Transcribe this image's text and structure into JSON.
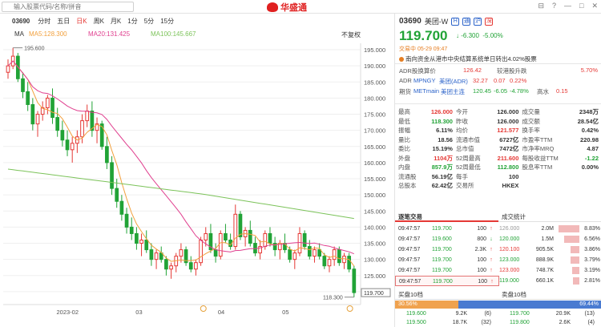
{
  "search": {
    "placeholder": "输入股票代码/名称/拼音"
  },
  "brand": {
    "name": "华盛通"
  },
  "window": {
    "buttons": [
      "⊟",
      "?",
      "—",
      "□",
      "✕"
    ]
  },
  "chart_toolbar": {
    "code": "03690",
    "periods": [
      "分时",
      "五日",
      "日K",
      "周K",
      "月K",
      "1分",
      "5分",
      "15分"
    ],
    "active_period": "日K"
  },
  "ma": {
    "label": "MA",
    "ma5": "MA5:128.300",
    "ma20": "MA20:131.425",
    "ma100": "MA100:145.667",
    "adjust": "不复权"
  },
  "chart_data": {
    "type": "candlestick",
    "x_labels": [
      "2023-02",
      "03",
      "04",
      "05"
    ],
    "y_ticks": [
      195,
      190,
      185,
      180,
      175,
      170,
      165,
      160,
      155,
      150,
      145,
      140,
      135,
      130,
      125,
      120
    ],
    "y_range": [
      116,
      197
    ],
    "high_marker": "195.600",
    "low_marker": "118.300",
    "last_price_tag": "119.700",
    "ma_colors": {
      "ma5": "#f2a03d",
      "ma20": "#e0408f",
      "ma100": "#7cc35a"
    },
    "up_color": "#e53935",
    "down_color": "#21a336",
    "candles": [
      [
        188,
        192,
        186,
        190
      ],
      [
        190,
        195.6,
        189,
        193
      ],
      [
        193,
        194,
        185,
        186
      ],
      [
        186,
        188,
        180,
        182
      ],
      [
        182,
        185,
        176,
        178
      ],
      [
        178,
        180,
        170,
        172
      ],
      [
        172,
        176,
        168,
        175
      ],
      [
        175,
        179,
        173,
        177
      ],
      [
        177,
        181,
        175,
        180
      ],
      [
        180,
        183,
        172,
        174
      ],
      [
        174,
        177,
        168,
        170
      ],
      [
        170,
        173,
        165,
        167
      ],
      [
        167,
        170,
        162,
        164
      ],
      [
        164,
        168,
        160,
        166
      ],
      [
        166,
        170,
        163,
        168
      ],
      [
        168,
        175,
        166,
        173
      ],
      [
        173,
        178,
        171,
        176
      ],
      [
        176,
        179,
        168,
        170
      ],
      [
        170,
        174,
        166,
        172
      ],
      [
        172,
        173,
        164,
        165
      ],
      [
        165,
        168,
        158,
        160
      ],
      [
        160,
        162,
        150,
        152
      ],
      [
        152,
        155,
        146,
        148
      ],
      [
        148,
        150,
        142,
        144
      ],
      [
        144,
        146,
        138,
        140
      ],
      [
        140,
        143,
        136,
        138
      ],
      [
        138,
        140,
        133,
        135
      ],
      [
        135,
        138,
        131,
        136
      ],
      [
        136,
        139,
        132,
        133
      ],
      [
        133,
        135,
        128,
        130
      ],
      [
        130,
        133,
        127,
        132
      ],
      [
        132,
        134,
        129,
        130
      ],
      [
        130,
        131,
        125,
        127
      ],
      [
        127,
        129,
        124,
        128
      ],
      [
        128,
        132,
        126,
        131
      ],
      [
        131,
        135,
        129,
        133
      ],
      [
        133,
        134,
        128,
        129
      ],
      [
        129,
        131,
        126,
        127
      ],
      [
        127,
        130,
        125,
        129
      ],
      [
        129,
        137,
        128,
        136
      ],
      [
        136,
        140,
        134,
        138
      ],
      [
        138,
        141,
        132,
        133
      ],
      [
        133,
        135,
        129,
        131
      ],
      [
        131,
        139,
        130,
        138
      ],
      [
        138,
        141,
        135,
        136
      ],
      [
        136,
        138,
        133,
        134
      ],
      [
        134,
        147,
        133,
        144
      ],
      [
        144,
        145,
        136,
        137
      ],
      [
        137,
        140,
        134,
        139
      ],
      [
        139,
        142,
        134,
        135
      ],
      [
        135,
        137,
        131,
        132
      ],
      [
        132,
        136,
        130,
        134
      ],
      [
        134,
        139,
        133,
        138
      ],
      [
        138,
        140,
        134,
        135
      ],
      [
        135,
        137,
        131,
        133
      ],
      [
        133,
        136,
        130,
        135
      ],
      [
        135,
        138,
        132,
        133
      ],
      [
        133,
        134,
        129,
        130
      ],
      [
        130,
        133,
        127,
        132
      ],
      [
        132,
        140,
        131,
        138
      ],
      [
        138,
        139,
        133,
        134
      ],
      [
        134,
        136,
        130,
        131
      ],
      [
        131,
        134,
        129,
        133
      ],
      [
        133,
        135,
        130,
        131
      ],
      [
        131,
        132,
        127,
        128
      ],
      [
        128,
        131,
        126,
        130
      ],
      [
        130,
        134,
        128,
        133
      ],
      [
        133,
        134,
        128,
        129
      ],
      [
        129,
        132,
        127,
        131
      ],
      [
        131,
        132,
        126,
        127
      ],
      [
        127,
        128,
        118.3,
        119.7
      ]
    ]
  },
  "quote": {
    "code": "03690",
    "name": "美团-W",
    "badges": [
      "H",
      "通",
      "沪",
      "深"
    ],
    "price": "119.700",
    "arrow": "↓",
    "change": "-6.300",
    "change_pct": "-5.00%",
    "trade_time": "交易中 05-29 09:47",
    "news": "南向资金从港市中央结算系统单日转出4.02%股票"
  },
  "adr": [
    {
      "label": "ADR股换算价",
      "value": "126.42",
      "label2": "较港股升跌",
      "value2": "5.70%"
    },
    {
      "label": "ADR",
      "code": "MPNGY",
      "name": "美团(ADR)",
      "value": "32.27",
      "chg": "0.07",
      "pct": "0.22%"
    },
    {
      "label": "期货",
      "code": "METmain",
      "name": "美团主连",
      "value": "120.45",
      "chg": "-6.05",
      "pct": "-4.78%",
      "label2": "高水",
      "value2": "0.15"
    }
  ],
  "stats": [
    [
      "最高",
      "126.000",
      "今开",
      "126.000",
      "成交量",
      "2348万"
    ],
    [
      "最低",
      "118.300",
      "昨收",
      "126.000",
      "成交额",
      "28.54亿"
    ],
    [
      "振幅",
      "6.11%",
      "均价",
      "121.577",
      "换手率",
      "0.42%"
    ],
    [
      "量比",
      "18.56",
      "流通市值",
      "6727亿",
      "市盈率TTM",
      "220.98"
    ],
    [
      "委比",
      "15.19%",
      "总市值",
      "7472亿",
      "市净率MRQ",
      "4.87"
    ],
    [
      "外盘",
      "1104万",
      "52周最高",
      "211.600",
      "每股收益TTM",
      "-1.22"
    ],
    [
      "内盘",
      "857.9万",
      "52周最低",
      "112.800",
      "股息率TTM",
      "0.00%"
    ],
    [
      "流通股",
      "56.19亿",
      "每手",
      "100",
      "",
      ""
    ],
    [
      "总股本",
      "62.42亿",
      "交易所",
      "HKEX",
      "",
      ""
    ]
  ],
  "tabs": {
    "trades": "逐笔交易",
    "stats": "成交统计",
    "book": "买盘10档",
    "book_sell": "卖盘10档"
  },
  "trades": [
    {
      "time": "09:47:57",
      "price": "119.700",
      "vol": "100",
      "dir": "↑"
    },
    {
      "time": "09:47:57",
      "price": "119.600",
      "vol": "800",
      "dir": "↓"
    },
    {
      "time": "09:47:57",
      "price": "119.700",
      "vol": "2.3K",
      "dir": "↑"
    },
    {
      "time": "09:47:57",
      "price": "119.700",
      "vol": "100",
      "dir": "↑"
    },
    {
      "time": "09:47:57",
      "price": "119.700",
      "vol": "100",
      "dir": "↑"
    },
    {
      "time": "09:47:57",
      "price": "119.700",
      "vol": "100",
      "dir": "↑"
    }
  ],
  "trade_stats": [
    {
      "price": "126.000",
      "vol": "2.0M",
      "pct": "8.83%",
      "frac": 0.88
    },
    {
      "price": "120.000",
      "vol": "1.5M",
      "pct": "6.56%",
      "frac": 0.65
    },
    {
      "price": "120.100",
      "vol": "905.5K",
      "pct": "3.86%",
      "frac": 0.38
    },
    {
      "price": "123.000",
      "vol": "888.9K",
      "pct": "3.79%",
      "frac": 0.37
    },
    {
      "price": "123.000",
      "vol": "748.7K",
      "pct": "3.19%",
      "frac": 0.31
    },
    {
      "price": "119.000",
      "vol": "660.1K",
      "pct": "2.81%",
      "frac": 0.28
    }
  ],
  "ratio": {
    "buy": "30.56%",
    "sell": "69.44%",
    "buy_frac": 0.3056
  },
  "bids": [
    {
      "price": "119.600",
      "vol": "9.2K",
      "n": "(6)"
    },
    {
      "price": "119.500",
      "vol": "18.7K",
      "n": "(32)"
    },
    {
      "price": "119.400",
      "vol": "30.4K",
      "n": "(15)"
    }
  ],
  "asks": [
    {
      "price": "119.700",
      "vol": "20.9K",
      "n": "(13)"
    },
    {
      "price": "119.800",
      "vol": "2.6K",
      "n": "(4)"
    },
    {
      "price": "119.900",
      "vol": "4.5K",
      "n": "(13)"
    }
  ]
}
